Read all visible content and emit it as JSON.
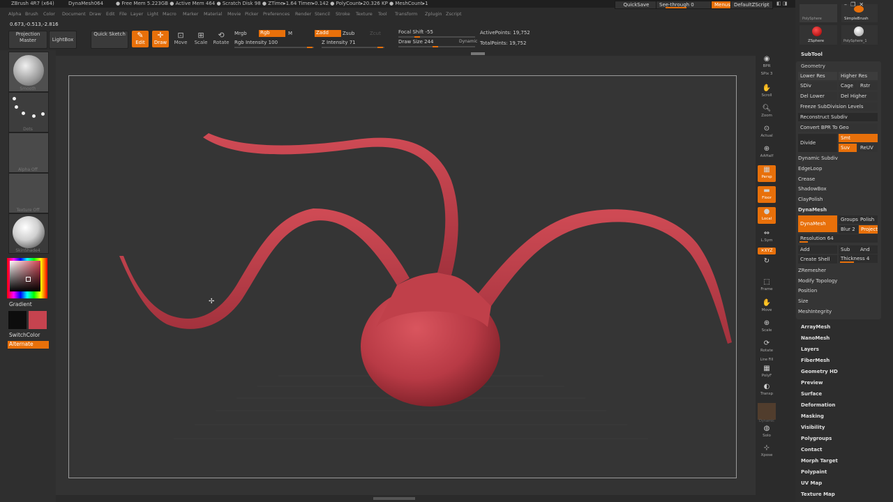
{
  "titlebar": {
    "app": "ZBrush 4R7 (x64)",
    "doc": "DynaMesh064",
    "stats": "● Free Mem 5.223GB ● Active Mem 464 ● Scratch Disk 98 ● ZTime▸1.64 Timer▸0.142 ● PolyCount▸20.326 KP ● MeshCount▸1",
    "quicksave": "QuickSave",
    "seethrough": "See-through  0",
    "menus": "Menus",
    "script": "DefaultZScript"
  },
  "menubar": [
    "Alpha",
    "Brush",
    "Color",
    "Document",
    "Draw",
    "Edit",
    "File",
    "Layer",
    "Light",
    "Macro",
    "Marker",
    "Material",
    "Movie",
    "Picker",
    "Preferences",
    "Render",
    "Stencil",
    "Stroke",
    "Texture",
    "Tool",
    "Transform",
    "Zplugin",
    "Zscript"
  ],
  "coords": "0.673,-0.513,-2.816",
  "toolbar": {
    "projection_master": "Projection Master",
    "lightbox": "LightBox",
    "quick_sketch": "Quick Sketch",
    "edit": "Edit",
    "draw": "Draw",
    "move": "Move",
    "scale": "Scale",
    "rotate": "Rotate",
    "mrgb": "Mrgb",
    "rgb": "Rgb",
    "m": "M",
    "rgb_intensity": "Rgb Intensity 100",
    "zadd": "Zadd",
    "zsub": "Zsub",
    "zcut": "Zcut",
    "z_intensity": "Z Intensity 71",
    "focal_shift": "Focal Shift -55",
    "draw_size": "Draw Size 244",
    "dynamic": "Dynamic",
    "active_points": "ActivePoints: 19,752",
    "total_points": "TotalPoints: 19,752"
  },
  "leftshelf": {
    "brush": "Smooth",
    "stroke": "Dots",
    "alpha": "Alpha Off",
    "texture": "Texture Off",
    "material": "SkinShade4",
    "gradient": "Gradient",
    "switchcolor": "SwitchColor",
    "alternate": "Alternate"
  },
  "rightshelf": {
    "bpr": "BPR",
    "spix": "SPix 3",
    "scroll": "Scroll",
    "zoom": "Zoom",
    "actual": "Actual",
    "aahalf": "AAHalf",
    "persp": "Persp",
    "floor": "Floor",
    "local": "Local",
    "lsym": "L.Sym",
    "xyz": "✕XYZ",
    "frame": "Frame",
    "move": "Move",
    "scale": "Scale",
    "rotate": "Rotate",
    "linefill": "Line Fill",
    "polyf": "PolyF",
    "transp": "Transp",
    "dynamic": "Dynamic",
    "solo": "Solo",
    "xpose": "Xpose"
  },
  "tray": {
    "tools": [
      "PolySphere",
      "SimpleBrush",
      "ZSphere",
      "PolySphere_1"
    ],
    "subtool": "SubTool",
    "geometry": "Geometry",
    "lower_res": "Lower Res",
    "higher_res": "Higher Res",
    "sdiv": "SDiv",
    "cage": "Cage",
    "rstr": "Rstr",
    "del_lower": "Del Lower",
    "del_higher": "Del Higher",
    "freeze": "Freeze SubDivision Levels",
    "reconstruct": "Reconstruct Subdiv",
    "convert_bpr": "Convert BPR To Geo",
    "divide": "Divide",
    "smt": "Smt",
    "suv": "Suv",
    "reuv": "ReUV",
    "dynamic_subdiv": "Dynamic Subdiv",
    "edgeloop": "EdgeLoop",
    "crease": "Crease",
    "shadowbox": "ShadowBox",
    "claypolish": "ClayPolish",
    "dynamesh_head": "DynaMesh",
    "dynamesh_btn": "DynaMesh",
    "groups": "Groups",
    "polish": "Polish",
    "blur": "Blur 2",
    "project": "Project",
    "resolution": "Resolution 64",
    "add": "Add",
    "sub": "Sub",
    "and": "And",
    "create_shell": "Create Shell",
    "thickness": "Thickness 4",
    "zremesher": "ZRemesher",
    "modify_topology": "Modify Topology",
    "position": "Position",
    "size": "Size",
    "meshintegrity": "MeshIntegrity",
    "subpalettes": [
      "ArrayMesh",
      "NanoMesh",
      "Layers",
      "FiberMesh",
      "Geometry HD",
      "Preview",
      "Surface",
      "Deformation",
      "Masking",
      "Visibility",
      "Polygroups",
      "Contact",
      "Morph Target",
      "Polypaint",
      "UV Map",
      "Texture Map"
    ]
  },
  "colors": {
    "accent": "#e8700a",
    "mesh": "#c6434f",
    "bg": "#333333"
  }
}
